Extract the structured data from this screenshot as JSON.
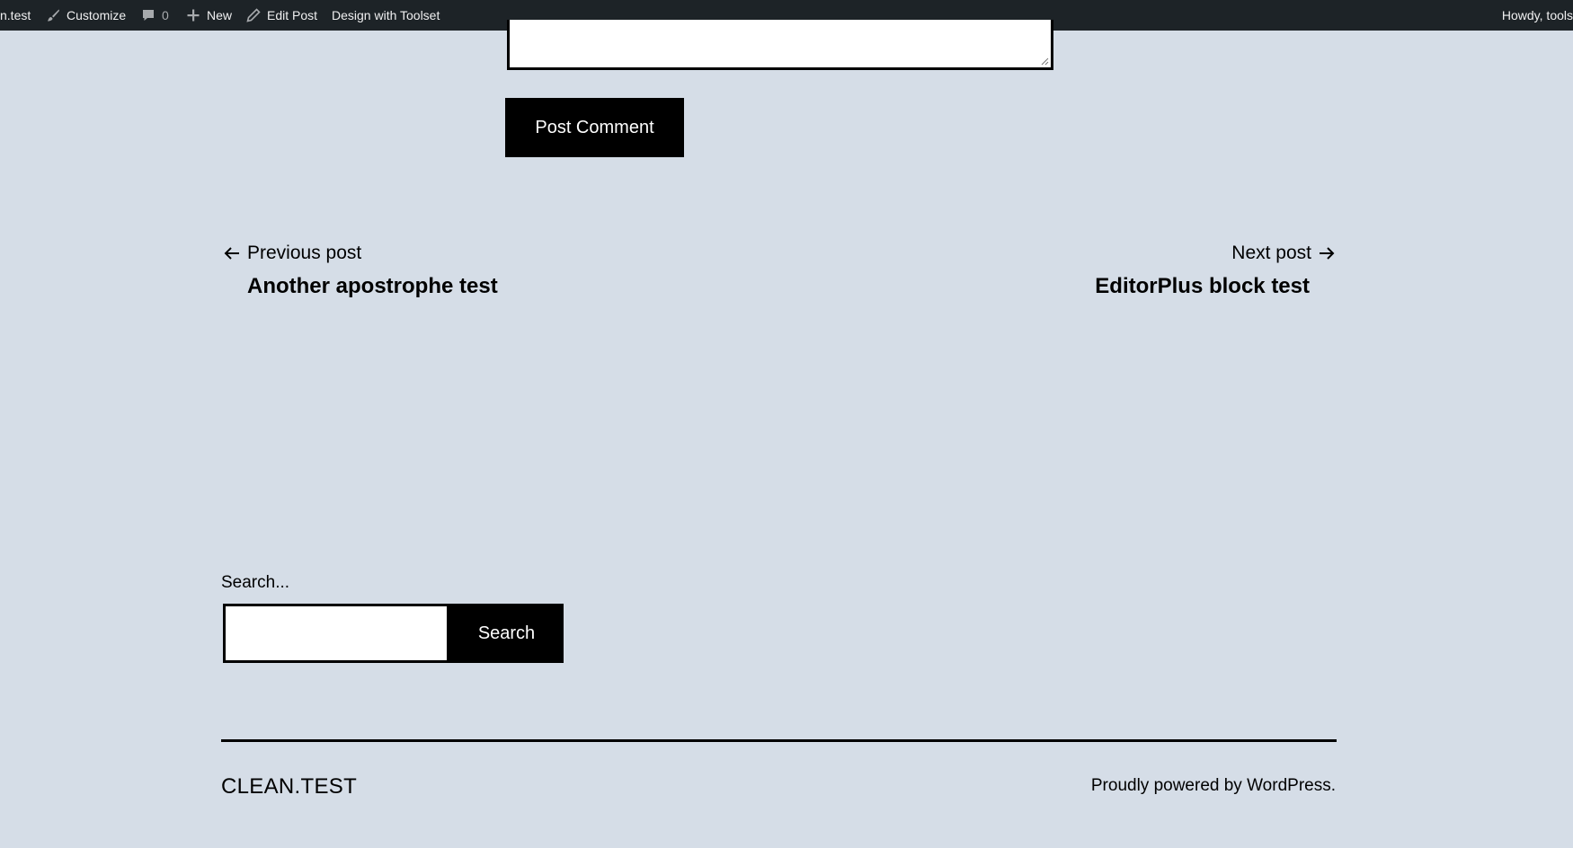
{
  "adminbar": {
    "site_name": "n.test",
    "customize_label": "Customize",
    "comments_count": "0",
    "new_label": "New",
    "edit_post_label": "Edit Post",
    "toolset_label": "Design with Toolset",
    "howdy_label": "Howdy, tools"
  },
  "comment_form": {
    "submit_label": "Post Comment"
  },
  "post_nav": {
    "previous": {
      "label": "Previous post",
      "title": "Another apostrophe test"
    },
    "next": {
      "label": "Next post",
      "title": "EditorPlus block test"
    }
  },
  "search": {
    "label": "Search...",
    "input_value": "",
    "button_label": "Search"
  },
  "footer": {
    "site_title": "CLEAN.TEST",
    "powered_prefix": "Proudly powered by ",
    "powered_link": "WordPress",
    "powered_suffix": "."
  },
  "colors": {
    "page_background": "#d5dde7",
    "adminbar_background": "#1d2327",
    "button_background": "#000000"
  }
}
